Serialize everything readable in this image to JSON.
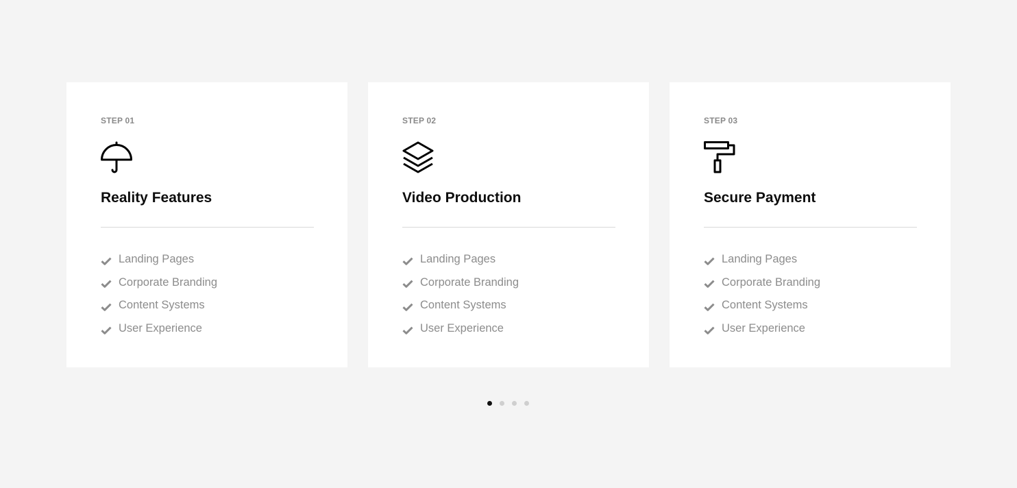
{
  "cards": [
    {
      "step": "STEP 01",
      "icon": "umbrella-icon",
      "title": "Reality Features",
      "features": [
        "Landing Pages",
        "Corporate Branding",
        "Content Systems",
        "User Experience"
      ]
    },
    {
      "step": "STEP 02",
      "icon": "layers-icon",
      "title": "Video Production",
      "features": [
        "Landing Pages",
        "Corporate Branding",
        "Content Systems",
        "User Experience"
      ]
    },
    {
      "step": "STEP 03",
      "icon": "paint-roller-icon",
      "title": "Secure Payment",
      "features": [
        "Landing Pages",
        "Corporate Branding",
        "Content Systems",
        "User Experience"
      ]
    }
  ],
  "pagination": {
    "total": 4,
    "active_index": 0
  },
  "colors": {
    "background": "#f4f4f4",
    "card": "#ffffff",
    "title": "#0d0d0d",
    "muted": "#8c8c8c",
    "check": "#8c8c8c",
    "dot_active": "#111111",
    "dot_inactive": "#cfcfcf"
  }
}
